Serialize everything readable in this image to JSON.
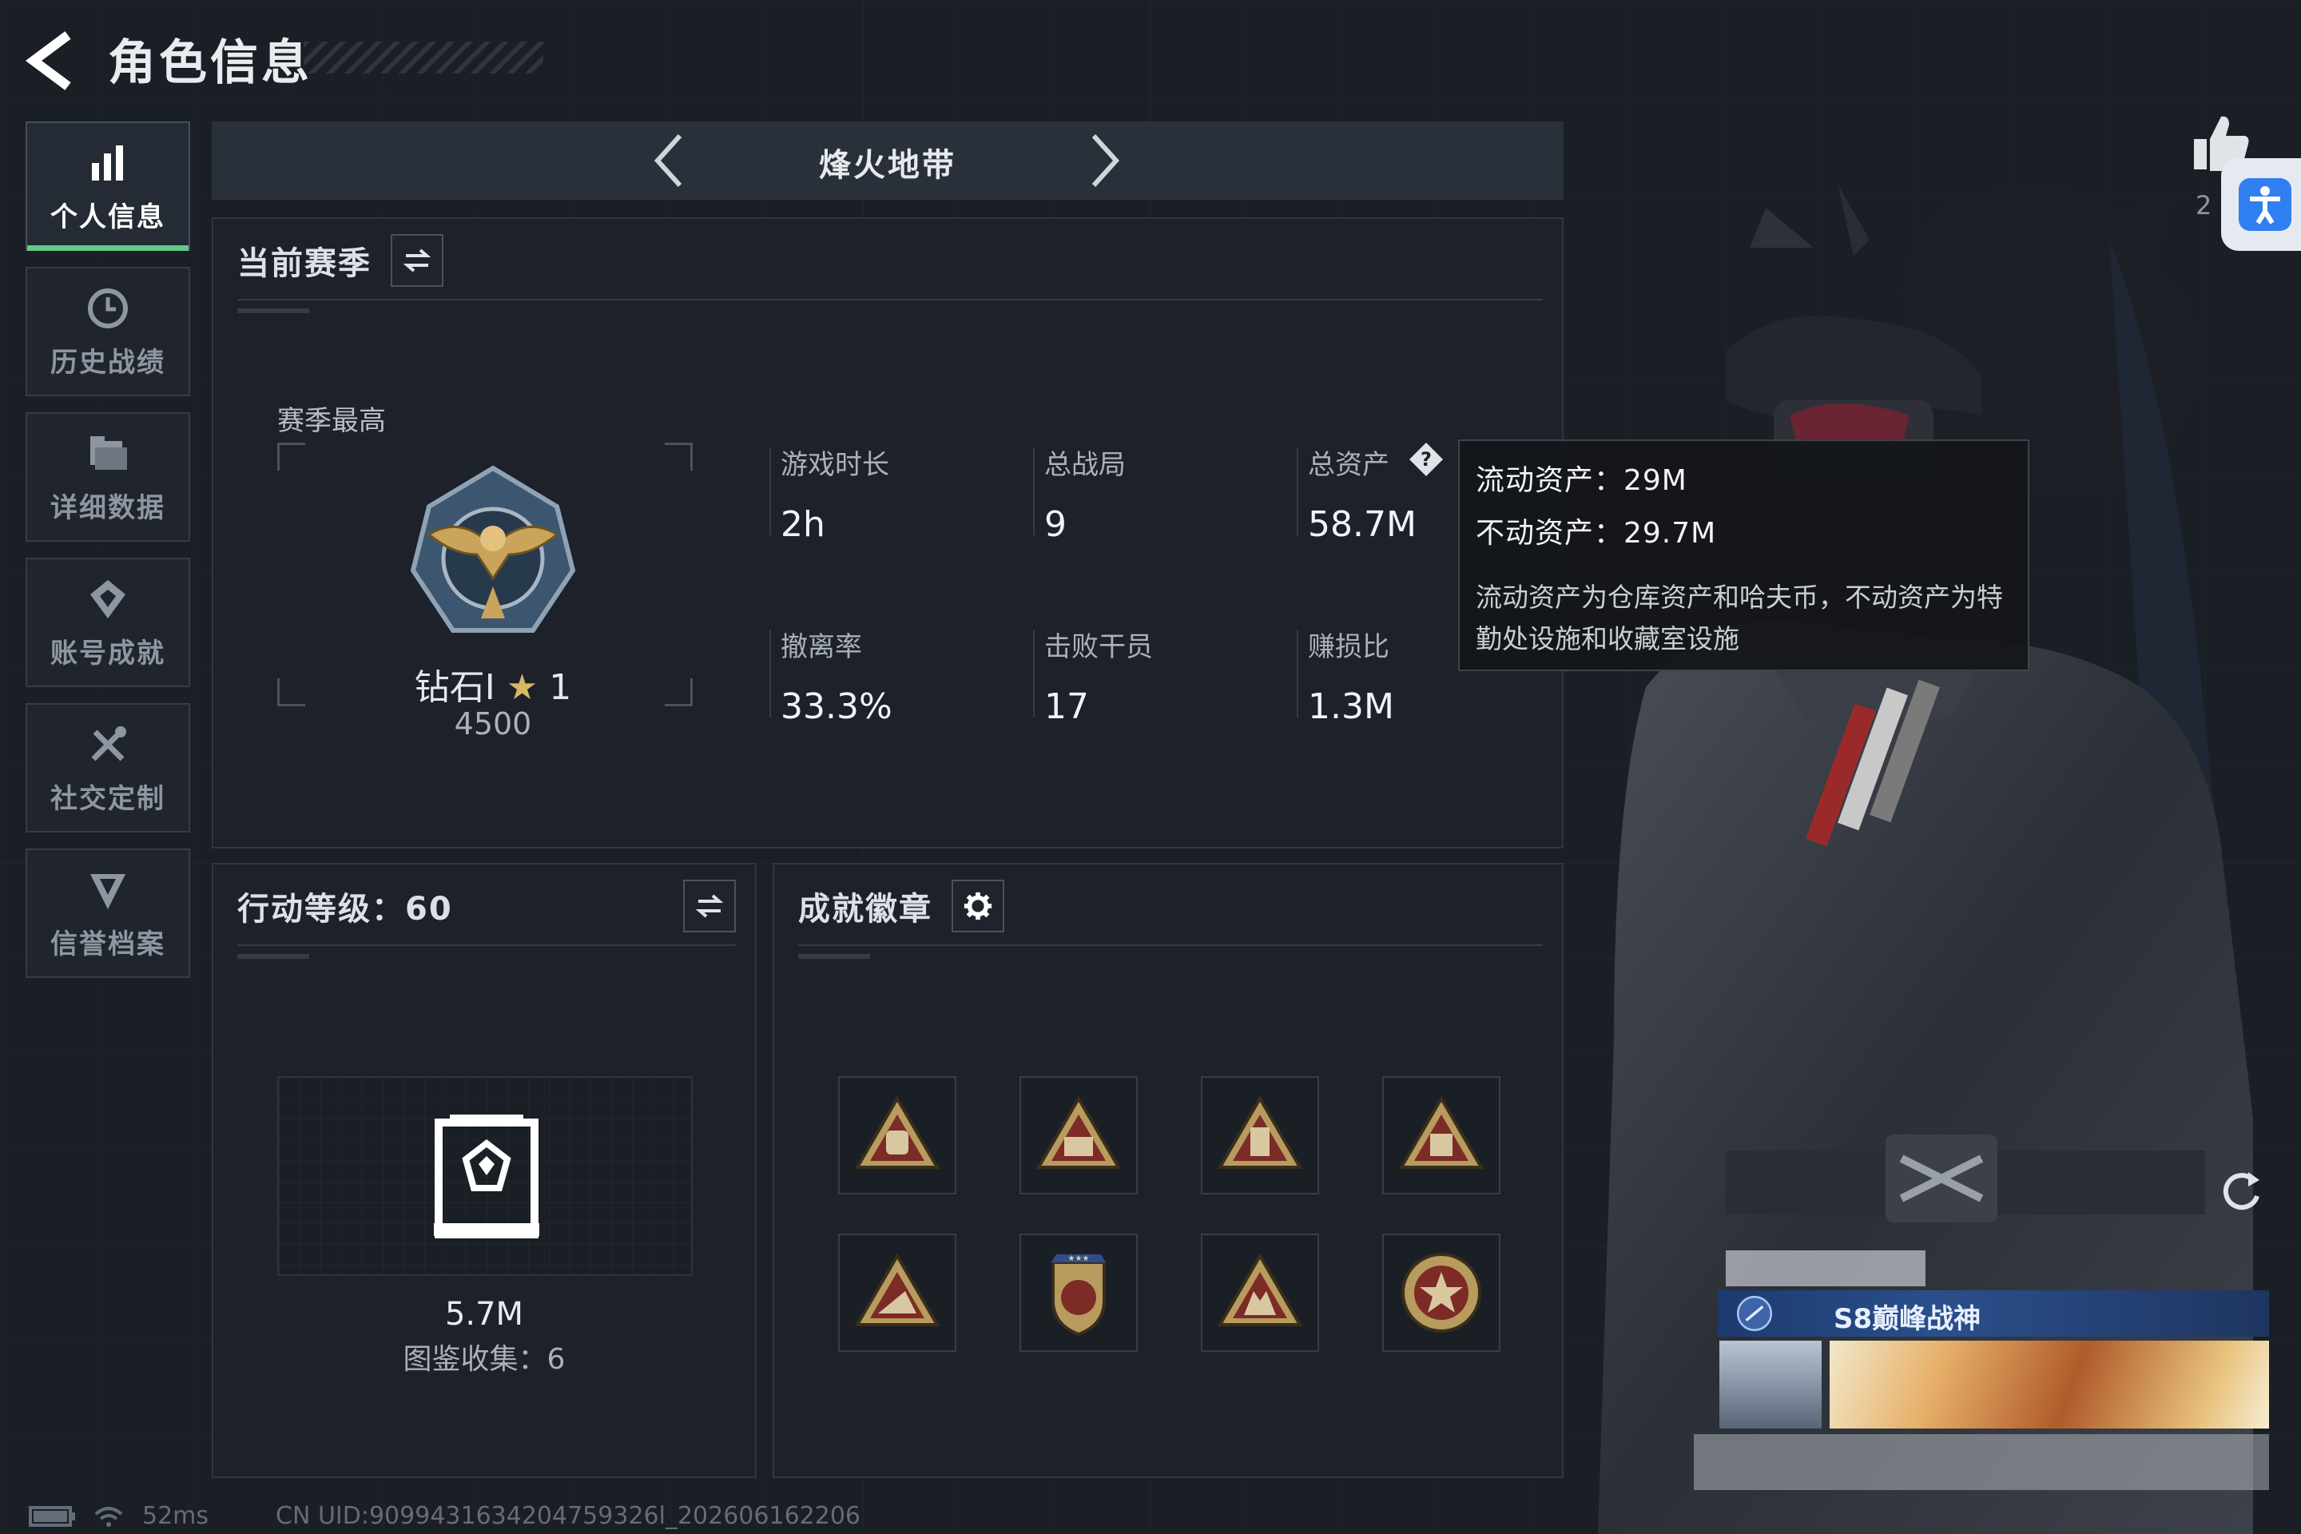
{
  "header": {
    "title": "角色信息"
  },
  "sidebar": {
    "items": [
      {
        "label": "个人信息",
        "icon": "bar-chart-icon",
        "active": true
      },
      {
        "label": "历史战绩",
        "icon": "clock-icon",
        "active": false
      },
      {
        "label": "详细数据",
        "icon": "folder-icon",
        "active": false
      },
      {
        "label": "账号成就",
        "icon": "achievement-icon",
        "active": false
      },
      {
        "label": "社交定制",
        "icon": "tools-icon",
        "active": false
      },
      {
        "label": "信誉档案",
        "icon": "shield-badge-icon",
        "active": false
      }
    ]
  },
  "mode": {
    "title": "烽火地带"
  },
  "season": {
    "title": "当前赛季",
    "highest_label": "赛季最高",
    "rank_name": "钻石I",
    "rank_stars": "1",
    "rank_score": "4500",
    "stats": [
      {
        "label": "游戏时长",
        "value": "2h"
      },
      {
        "label": "总战局",
        "value": "9"
      },
      {
        "label": "总资产",
        "value": "58.7M"
      },
      {
        "label": "撤离率",
        "value": "33.3%"
      },
      {
        "label": "击败干员",
        "value": "17"
      },
      {
        "label": "赚损比",
        "value": "1.3M"
      }
    ]
  },
  "tooltip": {
    "liquid": "流动资产：29M",
    "fixed": "不动资产：29.7M",
    "description": "流动资产为仓库资产和哈夫币，不动资产为特勤处设施和收藏室设施"
  },
  "level": {
    "title": "行动等级：60",
    "value": "5.7M",
    "collection": "图鉴收集：6"
  },
  "badges": {
    "title": "成就徽章",
    "items": [
      "55-triangle-badge-icon",
      "56-triangle-badge-icon",
      "57-triangle-badge-icon",
      "bag-triangle-badge-icon",
      "soldier-triangle-badge-icon",
      "star-shield-badge-icon",
      "squad-triangle-badge-icon",
      "star-medal-badge-icon"
    ]
  },
  "character": {
    "title_name": "S8巅峰战神",
    "like_count": "2"
  },
  "status": {
    "ping": "52ms",
    "uid": "CN UID:9099431634204759326l_202606162206"
  },
  "colors": {
    "accent": "#5ecb86",
    "background": "#1a1e25",
    "panel": "#1d2129"
  }
}
